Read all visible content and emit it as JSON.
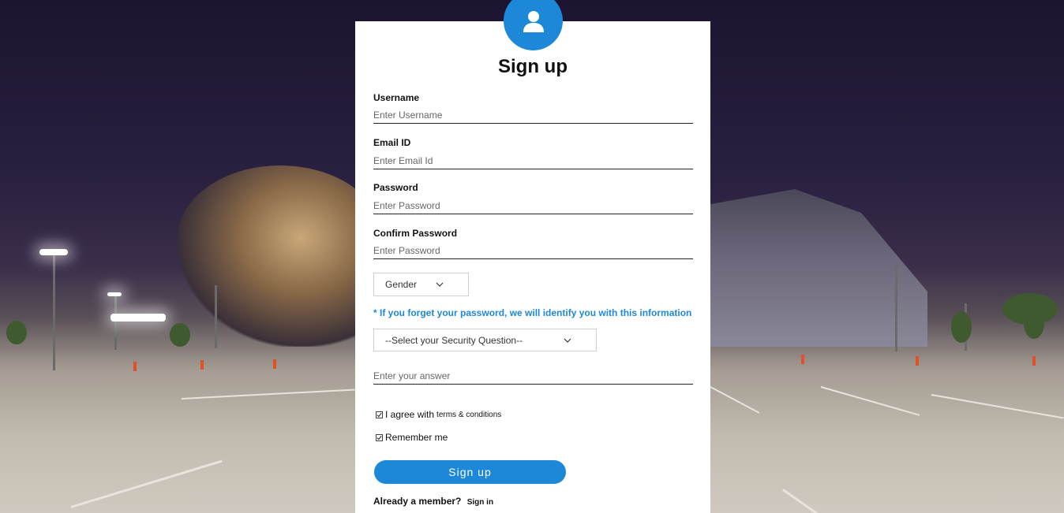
{
  "form": {
    "title": "Sign up",
    "username": {
      "label": "Username",
      "placeholder": "Enter Username"
    },
    "email": {
      "label": "Email ID",
      "placeholder": "Enter Email Id"
    },
    "password": {
      "label": "Password",
      "placeholder": "Enter Password"
    },
    "confirm_password": {
      "label": "Confirm Password",
      "placeholder": "Enter Password"
    },
    "gender": {
      "selected": "Gender"
    },
    "security_hint": "* If you forget your password, we will identify you with this information",
    "security_question": {
      "selected": "--Select your Security Question--"
    },
    "answer": {
      "placeholder": "Enter your answer"
    },
    "agree": {
      "label": "I agree with",
      "link": "terms & conditions",
      "checked": true
    },
    "remember": {
      "label": "Remember me",
      "checked": true
    },
    "submit_label": "Sign up",
    "member_text": "Already a member?",
    "signin_link": "Sign in"
  },
  "icons": {
    "avatar": "user-icon",
    "dropdown": "chevron-down-icon",
    "checkbox": "checkmark-icon"
  },
  "colors": {
    "accent": "#1e88d8",
    "panel": "#ffffff",
    "text": "#111111"
  }
}
